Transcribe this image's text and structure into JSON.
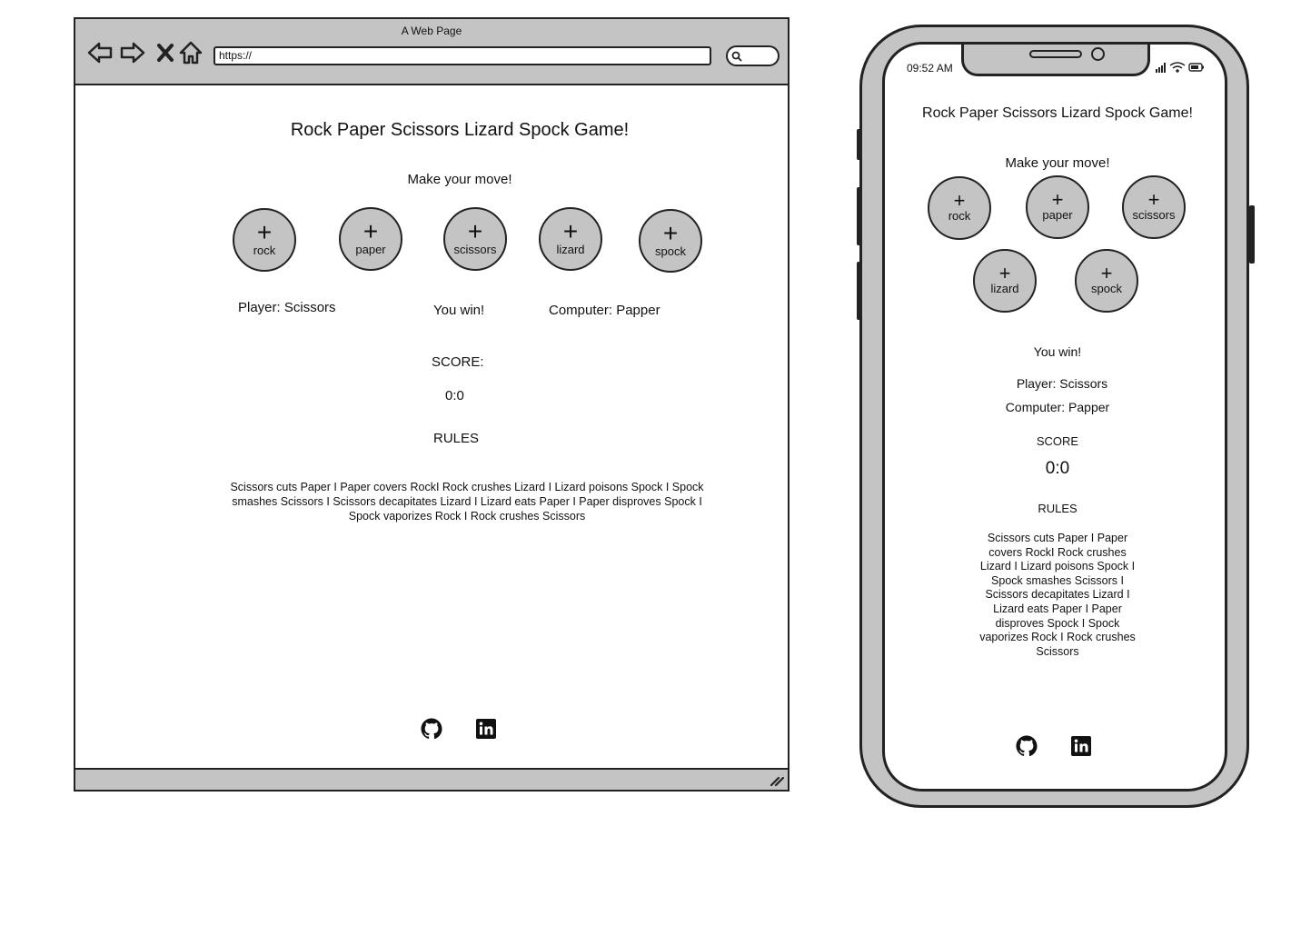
{
  "desktop": {
    "window_title": "A Web Page",
    "url": "https://",
    "heading": "Rock Paper Scissors Lizard Spock Game!",
    "prompt": "Make your move!",
    "choices": [
      {
        "label": "rock",
        "icon": "plus-icon"
      },
      {
        "label": "paper",
        "icon": "plus-icon"
      },
      {
        "label": "scissors",
        "icon": "plus-icon"
      },
      {
        "label": "lizard",
        "icon": "plus-icon"
      },
      {
        "label": "spock",
        "icon": "plus-icon"
      }
    ],
    "player_result": "Player: Scissors",
    "outcome": "You win!",
    "computer_result": "Computer: Papper",
    "score_label": "SCORE:",
    "score_value": "0:0",
    "rules_label": "RULES",
    "rules_text": "Scissors cuts Paper I Paper covers RockI Rock crushes Lizard I Lizard poisons Spock I Spock smashes Scissors I Scissors decapitates Lizard I Lizard eats Paper I Paper disproves Spock I Spock vaporizes Rock I Rock crushes Scissors",
    "social": [
      {
        "icon": "github-icon"
      },
      {
        "icon": "linkedin-icon"
      }
    ]
  },
  "mobile": {
    "status_time": "09:52 AM",
    "heading": "Rock Paper Scissors Lizard Spock Game!",
    "prompt": "Make your move!",
    "choices": [
      {
        "label": "rock",
        "icon": "plus-icon"
      },
      {
        "label": "paper",
        "icon": "plus-icon"
      },
      {
        "label": "scissors",
        "icon": "plus-icon"
      },
      {
        "label": "lizard",
        "icon": "plus-icon"
      },
      {
        "label": "spock",
        "icon": "plus-icon"
      }
    ],
    "outcome": "You win!",
    "player_result": "Player: Scissors",
    "computer_result": "Computer: Papper",
    "score_label": "SCORE",
    "score_value": "0:0",
    "rules_label": "RULES",
    "rules_text": "Scissors cuts Paper I Paper covers RockI Rock crushes Lizard I Lizard poisons Spock I Spock smashes Scissors I Scissors decapitates Lizard I Lizard eats Paper I Paper disproves Spock I Spock vaporizes Rock I Rock crushes Scissors",
    "social": [
      {
        "icon": "github-icon"
      },
      {
        "icon": "linkedin-icon"
      }
    ]
  },
  "colors": {
    "wireframe_fill": "#c4c4c4",
    "stroke": "#222222",
    "background": "#ffffff"
  }
}
